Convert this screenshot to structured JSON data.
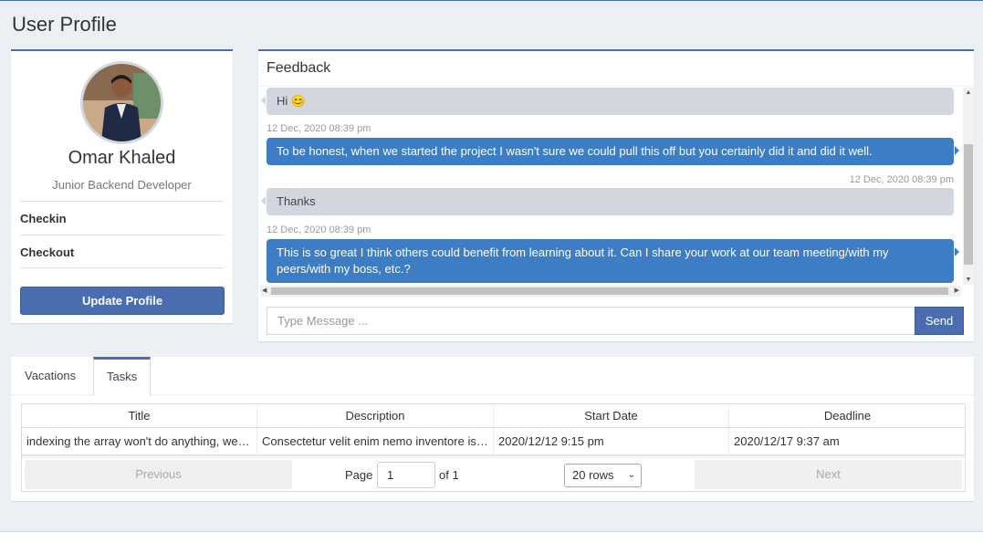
{
  "page": {
    "title": "User Profile"
  },
  "profile": {
    "name": "Omar Khaled",
    "role": "Junior Backend Developer",
    "rows": [
      "Checkin",
      "Checkout"
    ],
    "update_label": "Update Profile"
  },
  "feedback": {
    "title": "Feedback",
    "messages": [
      {
        "side": "left",
        "text": "Hi 😊",
        "timestamp": ""
      },
      {
        "side": "right",
        "text": "To be honest, when we started the project I wasn't sure we could pull this off but you certainly did it and did it well.",
        "timestamp": "12 Dec, 2020 08:39 pm"
      },
      {
        "side": "left",
        "text": "Thanks",
        "timestamp": "12 Dec, 2020 08:39 pm"
      },
      {
        "side": "right",
        "text": "This is so great I think others could benefit from learning about it. Can I share your work at our team meeting/with my peers/with my boss, etc.?",
        "timestamp": "12 Dec, 2020 08:39 pm"
      }
    ],
    "input_placeholder": "Type Message ...",
    "send_label": "Send"
  },
  "tabs": {
    "items": [
      "Vacations",
      "Tasks"
    ],
    "active": "Tasks"
  },
  "tasks_table": {
    "columns": [
      "Title",
      "Description",
      "Start Date",
      "Deadline"
    ],
    "rows": [
      [
        "indexing the array won't do anything, we …",
        "Consectetur velit enim nemo inventore is…",
        "2020/12/12 9:15 pm",
        "2020/12/17 9:37 am"
      ]
    ],
    "pager": {
      "previous_label": "Previous",
      "next_label": "Next",
      "page_label": "Page",
      "page_value": "1",
      "of_label": "of 1",
      "rows_option": "20 rows"
    }
  },
  "colors": {
    "accent": "#4a6db0",
    "bubble_right": "#3c7dc4",
    "bubble_left": "#d2d6de"
  }
}
